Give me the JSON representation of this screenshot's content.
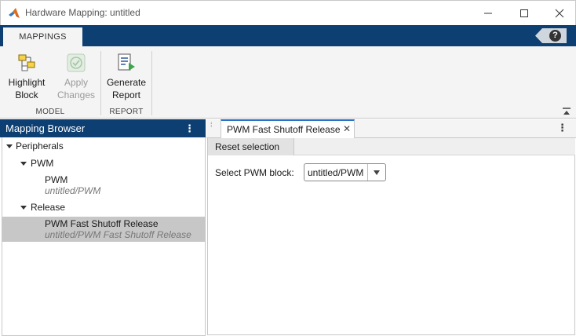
{
  "window": {
    "title": "Hardware Mapping: untitled",
    "minimize_glyph": "—",
    "maximize_glyph": "☐",
    "close_glyph": "✕"
  },
  "toolstrip": {
    "tab_label": "MAPPINGS",
    "help_glyph": "?",
    "buttons": {
      "highlight_line1": "Highlight",
      "highlight_line2": "Block",
      "apply_line1": "Apply",
      "apply_line2": "Changes",
      "generate_line1": "Generate",
      "generate_line2": "Report"
    },
    "sections": {
      "model": "MODEL",
      "report": "REPORT"
    }
  },
  "browser": {
    "title": "Mapping Browser",
    "menu_glyph": "⋮",
    "tree": {
      "peripherals": "Peripherals",
      "pwm_group": "PWM",
      "pwm_item": "PWM",
      "pwm_item_path": "untitled/PWM",
      "release_group": "Release",
      "release_item": "PWM Fast Shutoff Release",
      "release_item_path": "untitled/PWM Fast Shutoff Release"
    }
  },
  "document": {
    "tab_label": "PWM Fast Shutoff Release",
    "tab_close": "✕",
    "menu_glyph": "⋮",
    "reset_label": "Reset selection",
    "field_label": "Select PWM block:",
    "select_value": "untitled/PWM"
  },
  "colors": {
    "accent_blue": "#0d3f72",
    "tab_highlight": "#2a72c8",
    "selection_gray": "#c7c7c7"
  }
}
